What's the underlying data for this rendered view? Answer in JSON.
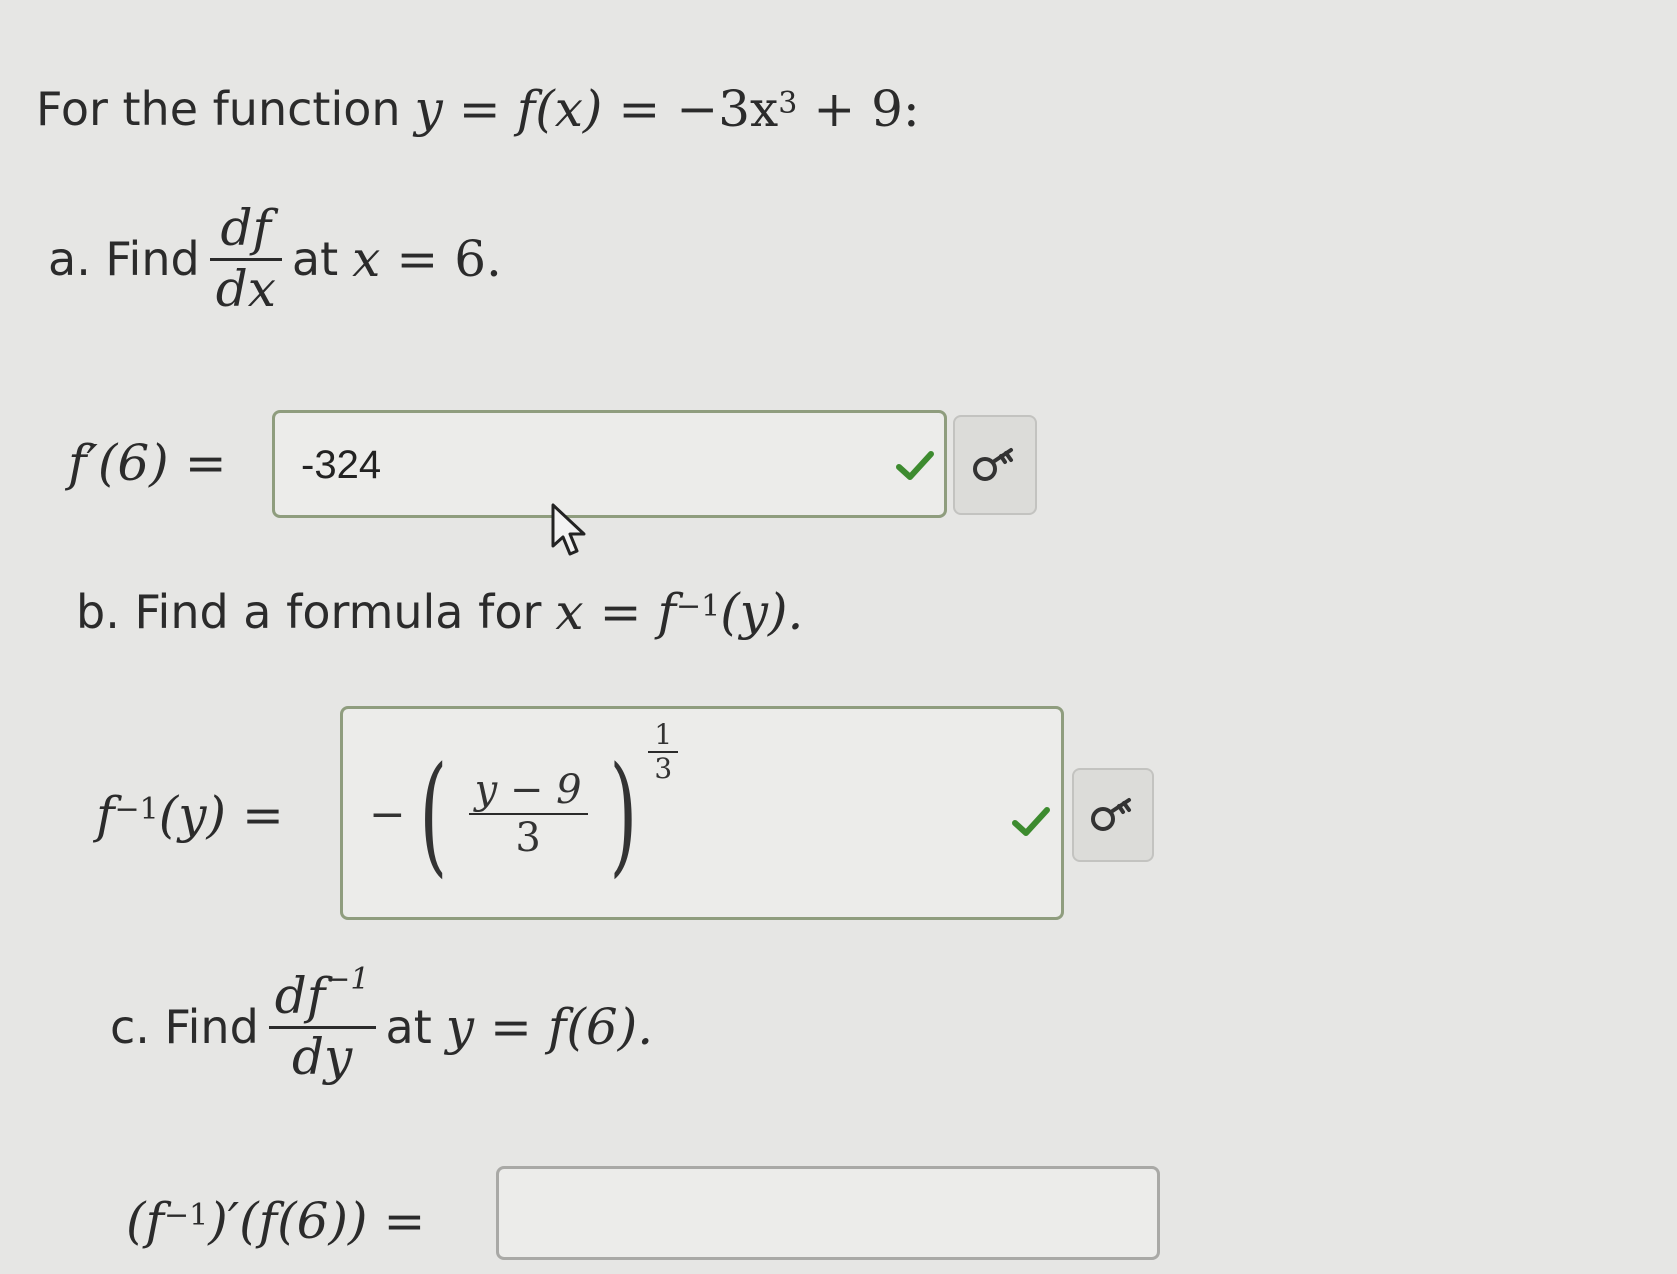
{
  "intro": {
    "text": "For the function",
    "y": "y",
    "eq": "=",
    "fx": "f(x)",
    "rhs_a": "−3x",
    "rhs_exp": "3",
    "rhs_b": "+ 9:"
  },
  "part_a": {
    "prefix": "a. Find",
    "num": "df",
    "den": "dx",
    "at": "at",
    "var": "x",
    "eq": "=",
    "value": "6.",
    "answer_label": "f′(6)",
    "answer_value": "-324"
  },
  "part_b": {
    "prefix": "b. Find a formula for",
    "lhs": "x",
    "eq": "=",
    "rhs": "f",
    "rhs_exp": "−1",
    "rhs_arg": "(y).",
    "answer_label_f": "f",
    "answer_label_exp": "−1",
    "answer_label_arg": "(y)",
    "answer_neg": "−",
    "answer_num": "y − 9",
    "answer_den": "3",
    "answer_exp_num": "1",
    "answer_exp_den": "3"
  },
  "part_c": {
    "prefix": "c. Find",
    "num_f": "df",
    "num_exp": "−1",
    "den": "dy",
    "at": "at",
    "var": "y",
    "eq": "=",
    "value": "f(6).",
    "answer_label_open": "(f",
    "answer_label_exp": "−1",
    "answer_label_rest": ")′(f(6))",
    "answer_value": ""
  },
  "colors": {
    "check": "#3d8b2f",
    "box_border": "#8f9d7e",
    "background": "#e6e6e4"
  },
  "icons": {
    "correct": "check-icon",
    "key": "key-icon",
    "cursor": "mouse-pointer-icon"
  }
}
